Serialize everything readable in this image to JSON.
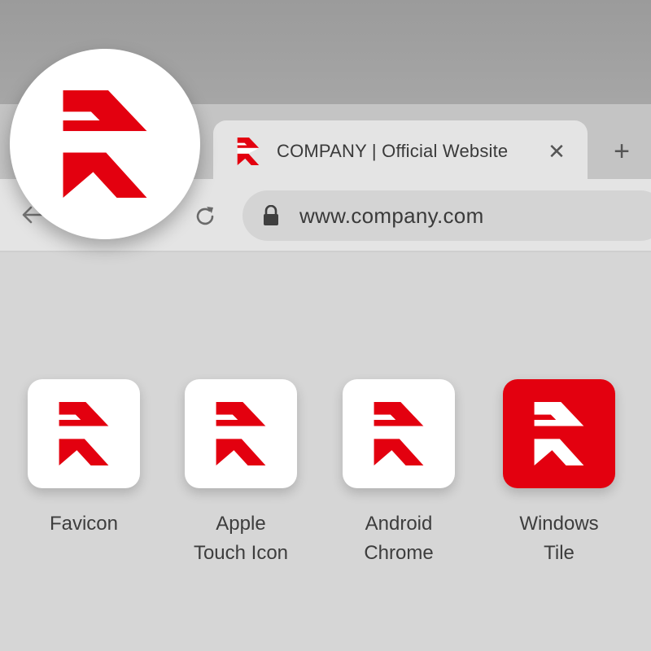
{
  "colors": {
    "brand_red": "#e3000f",
    "brand_white": "#ffffff",
    "tab_bg": "#e4e4e4",
    "toolbar_bg": "#e4e4e4",
    "omnibox_bg": "#d4d4d4"
  },
  "tab": {
    "title": "COMPANY | Official Website",
    "close_glyph": "✕",
    "favicon_icon": "brand-r-logo-icon"
  },
  "new_tab_glyph": "+",
  "toolbar": {
    "back_icon": "arrow-left-icon",
    "reload_icon": "reload-icon",
    "lock_icon": "lock-icon",
    "url": "www.company.com"
  },
  "zoom_badge": {
    "icon": "brand-r-logo-icon"
  },
  "icon_variants": [
    {
      "label_lines": [
        "Favicon"
      ],
      "style": "white"
    },
    {
      "label_lines": [
        "Apple",
        "Touch Icon"
      ],
      "style": "white"
    },
    {
      "label_lines": [
        "Android",
        "Chrome"
      ],
      "style": "white"
    },
    {
      "label_lines": [
        "Windows",
        "Tile"
      ],
      "style": "red"
    }
  ]
}
